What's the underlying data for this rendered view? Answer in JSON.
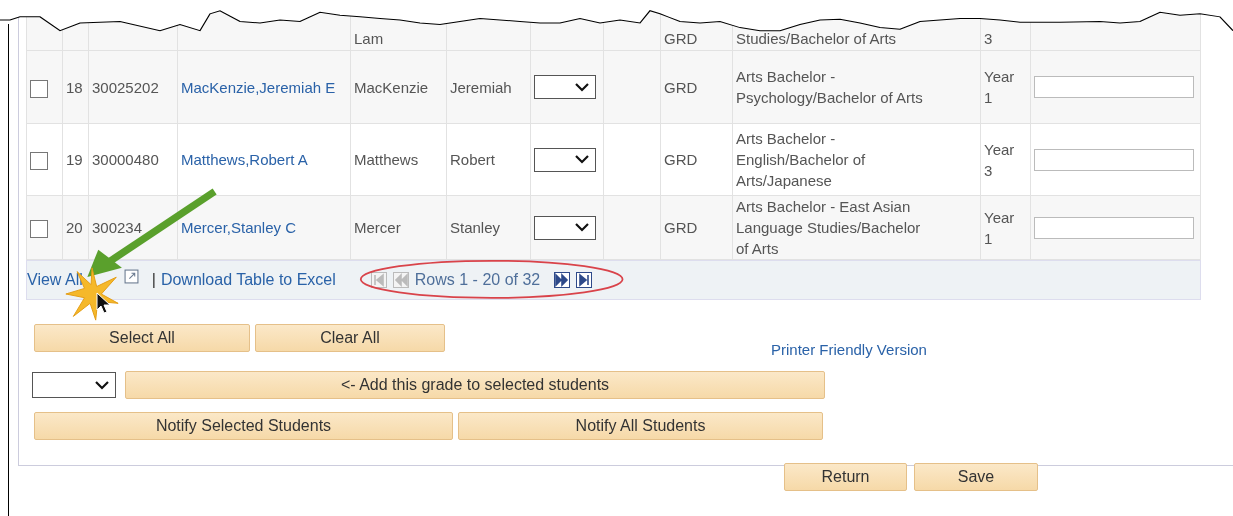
{
  "partial_row": {
    "last_name": "Lam",
    "level": "GRD",
    "program": "Studies/Bachelor of Arts",
    "year": "3"
  },
  "rows": [
    {
      "checked": false,
      "num": "18",
      "id": "30025202",
      "name": "MacKenzie,Jeremiah E",
      "last_name": "MacKenzie",
      "first_name": "Jeremiah",
      "level": "GRD",
      "program": "Arts Bachelor - Psychology/Bachelor of Arts",
      "year": "Year 1"
    },
    {
      "checked": false,
      "num": "19",
      "id": "30000480",
      "name": "Matthews,Robert A",
      "last_name": "Matthews",
      "first_name": "Robert",
      "level": "GRD",
      "program": "Arts Bachelor - English/Bachelor of Arts/Japanese",
      "year": "Year 3"
    },
    {
      "checked": false,
      "num": "20",
      "id": "300234",
      "name": "Mercer,Stanley C",
      "last_name": "Mercer",
      "first_name": "Stanley",
      "level": "GRD",
      "program": "Arts Bachelor - East Asian Language Studies/Bachelor of Arts",
      "year": "Year 1"
    }
  ],
  "footer": {
    "view_all": "View All",
    "separator": "|",
    "download": "Download Table to Excel",
    "pager": [
      {
        "kind": "first",
        "disabled": true
      },
      {
        "kind": "prev",
        "disabled": true
      }
    ],
    "rows_text": "Rows 1 - 20 of 32",
    "pager_next": [
      {
        "kind": "next",
        "disabled": false
      },
      {
        "kind": "last",
        "disabled": false
      }
    ]
  },
  "buttons": {
    "select_all": "Select All",
    "clear_all": "Clear All",
    "printer": "Printer Friendly Version",
    "add_grade": "<- Add this grade to selected students",
    "notify_selected": "Notify Selected Students",
    "notify_all": "Notify All Students",
    "return": "Return",
    "save": "Save"
  }
}
